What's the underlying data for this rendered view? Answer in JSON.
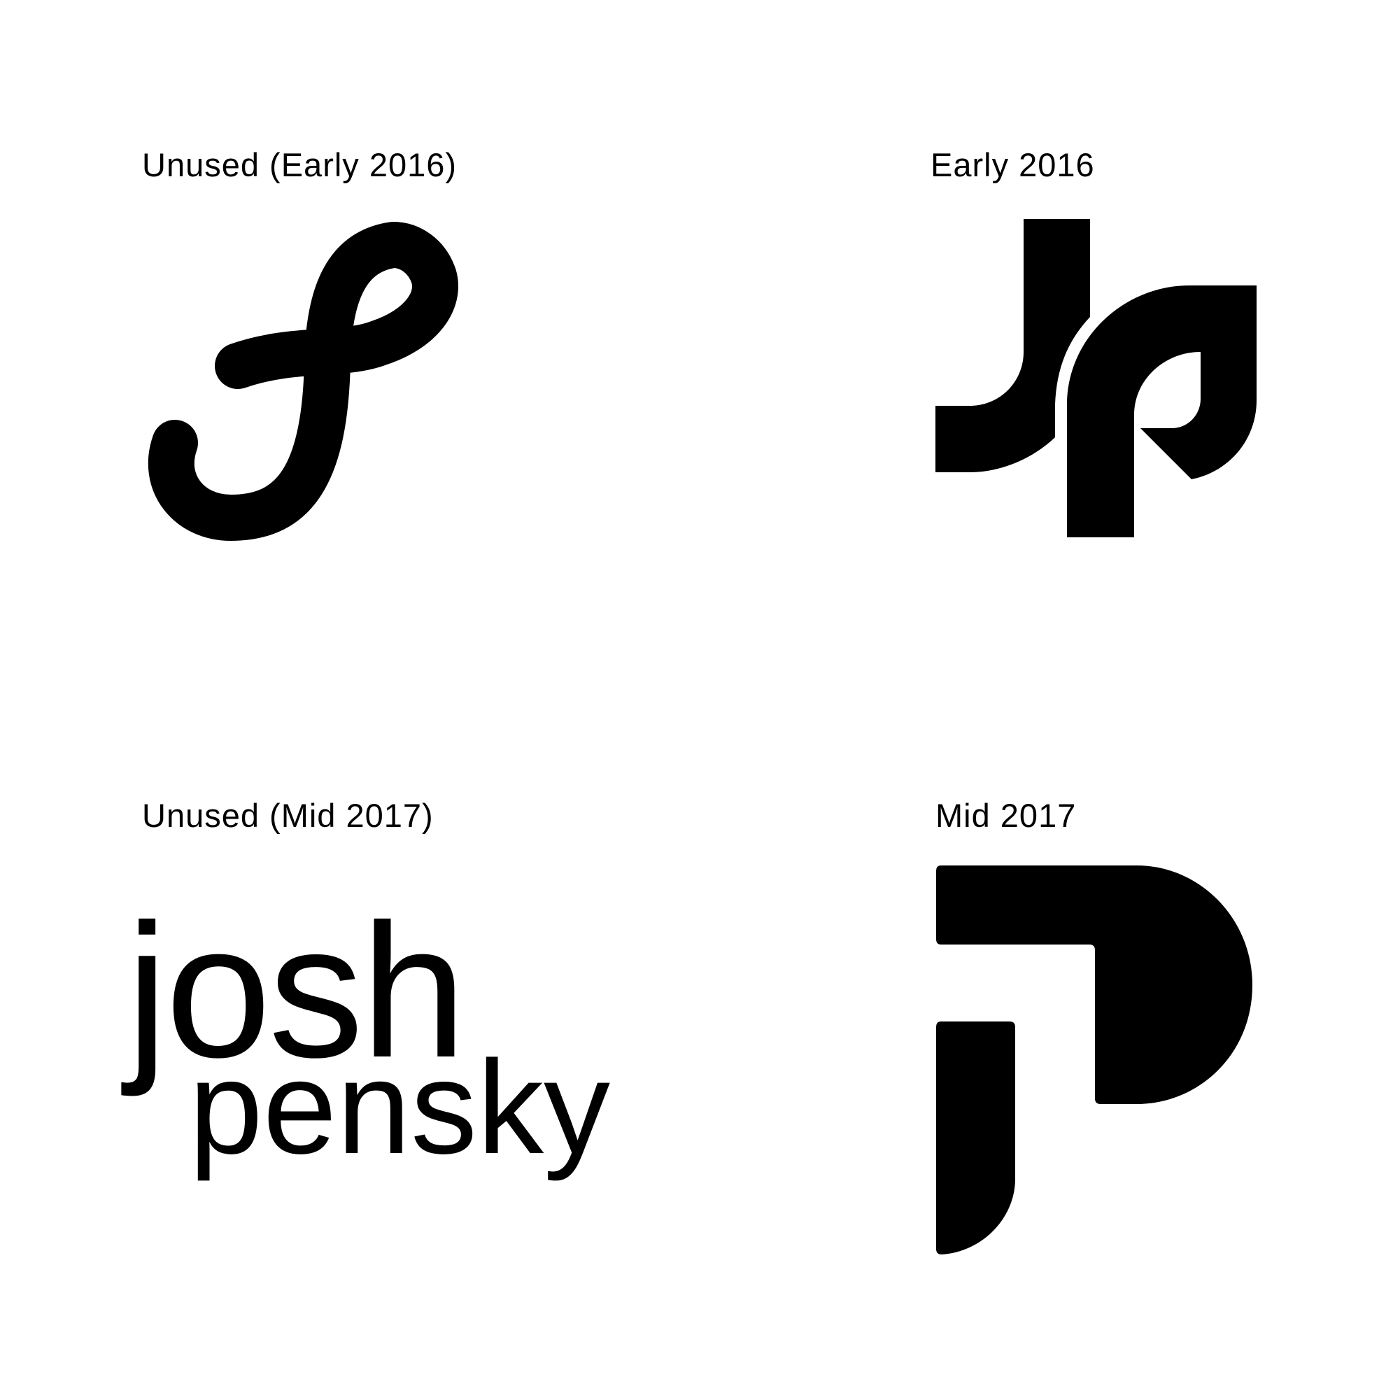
{
  "colors": {
    "background": "#ffffff",
    "ink": "#000000"
  },
  "panels": [
    {
      "caption": "Unused (Early 2016)",
      "logo": "script-s-loop-mark"
    },
    {
      "caption": "Early 2016",
      "logo": "jp-monogram-mark"
    },
    {
      "caption": "Unused (Mid 2017)",
      "logo": "josh-pensky-wordmark",
      "wordmark": {
        "line1": "josh",
        "line2": "pensky"
      }
    },
    {
      "caption": "Mid 2017",
      "logo": "jp-letterform-mark"
    }
  ]
}
